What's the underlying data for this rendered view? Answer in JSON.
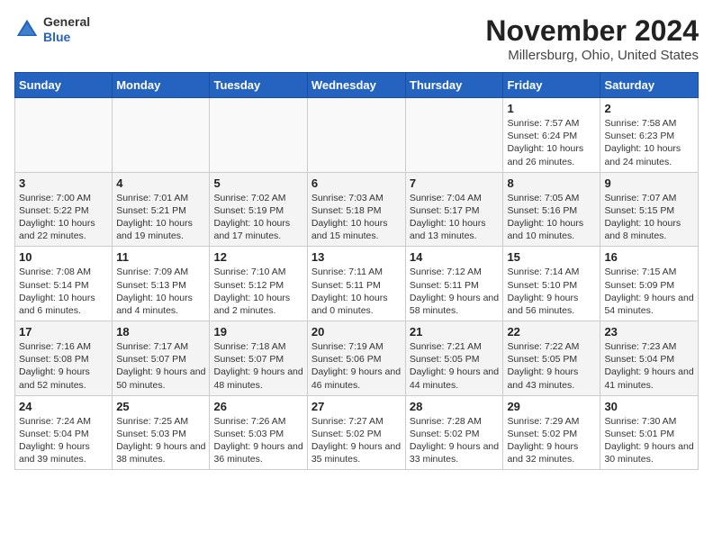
{
  "header": {
    "logo": {
      "general": "General",
      "blue": "Blue"
    },
    "title": "November 2024",
    "subtitle": "Millersburg, Ohio, United States"
  },
  "calendar": {
    "days_of_week": [
      "Sunday",
      "Monday",
      "Tuesday",
      "Wednesday",
      "Thursday",
      "Friday",
      "Saturday"
    ],
    "weeks": [
      [
        {
          "day": "",
          "info": ""
        },
        {
          "day": "",
          "info": ""
        },
        {
          "day": "",
          "info": ""
        },
        {
          "day": "",
          "info": ""
        },
        {
          "day": "",
          "info": ""
        },
        {
          "day": "1",
          "info": "Sunrise: 7:57 AM\nSunset: 6:24 PM\nDaylight: 10 hours and 26 minutes."
        },
        {
          "day": "2",
          "info": "Sunrise: 7:58 AM\nSunset: 6:23 PM\nDaylight: 10 hours and 24 minutes."
        }
      ],
      [
        {
          "day": "3",
          "info": "Sunrise: 7:00 AM\nSunset: 5:22 PM\nDaylight: 10 hours and 22 minutes."
        },
        {
          "day": "4",
          "info": "Sunrise: 7:01 AM\nSunset: 5:21 PM\nDaylight: 10 hours and 19 minutes."
        },
        {
          "day": "5",
          "info": "Sunrise: 7:02 AM\nSunset: 5:19 PM\nDaylight: 10 hours and 17 minutes."
        },
        {
          "day": "6",
          "info": "Sunrise: 7:03 AM\nSunset: 5:18 PM\nDaylight: 10 hours and 15 minutes."
        },
        {
          "day": "7",
          "info": "Sunrise: 7:04 AM\nSunset: 5:17 PM\nDaylight: 10 hours and 13 minutes."
        },
        {
          "day": "8",
          "info": "Sunrise: 7:05 AM\nSunset: 5:16 PM\nDaylight: 10 hours and 10 minutes."
        },
        {
          "day": "9",
          "info": "Sunrise: 7:07 AM\nSunset: 5:15 PM\nDaylight: 10 hours and 8 minutes."
        }
      ],
      [
        {
          "day": "10",
          "info": "Sunrise: 7:08 AM\nSunset: 5:14 PM\nDaylight: 10 hours and 6 minutes."
        },
        {
          "day": "11",
          "info": "Sunrise: 7:09 AM\nSunset: 5:13 PM\nDaylight: 10 hours and 4 minutes."
        },
        {
          "day": "12",
          "info": "Sunrise: 7:10 AM\nSunset: 5:12 PM\nDaylight: 10 hours and 2 minutes."
        },
        {
          "day": "13",
          "info": "Sunrise: 7:11 AM\nSunset: 5:11 PM\nDaylight: 10 hours and 0 minutes."
        },
        {
          "day": "14",
          "info": "Sunrise: 7:12 AM\nSunset: 5:11 PM\nDaylight: 9 hours and 58 minutes."
        },
        {
          "day": "15",
          "info": "Sunrise: 7:14 AM\nSunset: 5:10 PM\nDaylight: 9 hours and 56 minutes."
        },
        {
          "day": "16",
          "info": "Sunrise: 7:15 AM\nSunset: 5:09 PM\nDaylight: 9 hours and 54 minutes."
        }
      ],
      [
        {
          "day": "17",
          "info": "Sunrise: 7:16 AM\nSunset: 5:08 PM\nDaylight: 9 hours and 52 minutes."
        },
        {
          "day": "18",
          "info": "Sunrise: 7:17 AM\nSunset: 5:07 PM\nDaylight: 9 hours and 50 minutes."
        },
        {
          "day": "19",
          "info": "Sunrise: 7:18 AM\nSunset: 5:07 PM\nDaylight: 9 hours and 48 minutes."
        },
        {
          "day": "20",
          "info": "Sunrise: 7:19 AM\nSunset: 5:06 PM\nDaylight: 9 hours and 46 minutes."
        },
        {
          "day": "21",
          "info": "Sunrise: 7:21 AM\nSunset: 5:05 PM\nDaylight: 9 hours and 44 minutes."
        },
        {
          "day": "22",
          "info": "Sunrise: 7:22 AM\nSunset: 5:05 PM\nDaylight: 9 hours and 43 minutes."
        },
        {
          "day": "23",
          "info": "Sunrise: 7:23 AM\nSunset: 5:04 PM\nDaylight: 9 hours and 41 minutes."
        }
      ],
      [
        {
          "day": "24",
          "info": "Sunrise: 7:24 AM\nSunset: 5:04 PM\nDaylight: 9 hours and 39 minutes."
        },
        {
          "day": "25",
          "info": "Sunrise: 7:25 AM\nSunset: 5:03 PM\nDaylight: 9 hours and 38 minutes."
        },
        {
          "day": "26",
          "info": "Sunrise: 7:26 AM\nSunset: 5:03 PM\nDaylight: 9 hours and 36 minutes."
        },
        {
          "day": "27",
          "info": "Sunrise: 7:27 AM\nSunset: 5:02 PM\nDaylight: 9 hours and 35 minutes."
        },
        {
          "day": "28",
          "info": "Sunrise: 7:28 AM\nSunset: 5:02 PM\nDaylight: 9 hours and 33 minutes."
        },
        {
          "day": "29",
          "info": "Sunrise: 7:29 AM\nSunset: 5:02 PM\nDaylight: 9 hours and 32 minutes."
        },
        {
          "day": "30",
          "info": "Sunrise: 7:30 AM\nSunset: 5:01 PM\nDaylight: 9 hours and 30 minutes."
        }
      ]
    ]
  }
}
